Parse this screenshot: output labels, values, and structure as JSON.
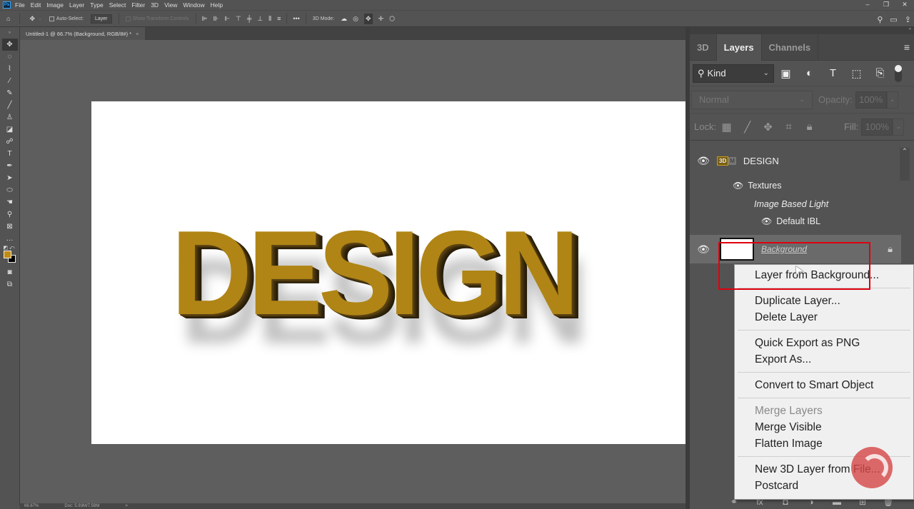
{
  "menubar": {
    "app_icon": "Ps",
    "items": [
      "File",
      "Edit",
      "Image",
      "Layer",
      "Type",
      "Select",
      "Filter",
      "3D",
      "View",
      "Window",
      "Help"
    ],
    "window_controls": [
      "minimize-icon",
      "restore-icon",
      "close-icon"
    ]
  },
  "options_bar": {
    "home_icon": "home-icon",
    "move_icon": "move-icon",
    "auto_select_label": "Auto-Select:",
    "auto_select_checked": false,
    "auto_select_target": "Layer",
    "show_transform_label": "Show Transform Controls",
    "more_label": "•••",
    "mode_label": "3D Mode:",
    "right_icons": [
      "search-icon",
      "workspace-icon",
      "share-icon"
    ]
  },
  "document_tab": {
    "title": "Untitled-1 @ 66.7% (Background, RGB/8#) *",
    "close": "×"
  },
  "tools": [
    "move",
    "elliptical-marquee",
    "polygonal-lasso",
    "magic-wand",
    "eyedropper",
    "brush",
    "clone-stamp",
    "eraser",
    "smudge",
    "type",
    "pen",
    "path-selection",
    "ellipse",
    "hand",
    "zoom",
    "frame",
    "more",
    "swap-colors",
    "color-swatches",
    "quick-mask",
    "screen-mode"
  ],
  "colors": {
    "foreground": "#c08c14",
    "background": "#000000"
  },
  "canvas": {
    "text": "DESIGN",
    "text_color": "#b08515"
  },
  "statusbar": {
    "zoom": "66.67%",
    "doc": "Doc: 5.93M/7.59M",
    "arrow": ">"
  },
  "panel": {
    "tabs": [
      "3D",
      "Layers",
      "Channels"
    ],
    "active_tab": "Layers",
    "filter_kind": "Kind",
    "blend_mode": "Normal",
    "opacity_label": "Opacity:",
    "opacity_value": "100%",
    "lock_label": "Lock:",
    "fill_label": "Fill:",
    "fill_value": "100%"
  },
  "layers": {
    "design": {
      "badge_3d": "3D",
      "badge_m": "M",
      "name": "DESIGN"
    },
    "textures": "Textures",
    "ibl": "Image Based Light",
    "default_ibl": "Default IBL",
    "background": "Background"
  },
  "context_menu": {
    "groups": [
      [
        {
          "label": "Layer from Background...",
          "enabled": true
        }
      ],
      [
        {
          "label": "Duplicate Layer...",
          "enabled": true
        },
        {
          "label": "Delete Layer",
          "enabled": true
        }
      ],
      [
        {
          "label": "Quick Export as PNG",
          "enabled": true
        },
        {
          "label": "Export As...",
          "enabled": true
        }
      ],
      [
        {
          "label": "Convert to Smart Object",
          "enabled": true
        }
      ],
      [
        {
          "label": "Merge Layers",
          "enabled": false
        },
        {
          "label": "Merge Visible",
          "enabled": true
        },
        {
          "label": "Flatten Image",
          "enabled": true
        }
      ],
      [
        {
          "label": "New 3D Layer from File...",
          "enabled": true
        },
        {
          "label": "Postcard",
          "enabled": true
        }
      ]
    ],
    "item_0": "Layer from Background...",
    "item_1": "Duplicate Layer...",
    "item_2": "Delete Layer",
    "item_3": "Quick Export as PNG",
    "item_4": "Export As...",
    "item_5": "Convert to Smart Object",
    "item_6": "Merge Layers",
    "item_7": "Merge Visible",
    "item_8": "Flatten Image",
    "item_9": "New 3D Layer from File...",
    "item_10": "Postcard"
  },
  "highlight_color": "#e0000e"
}
